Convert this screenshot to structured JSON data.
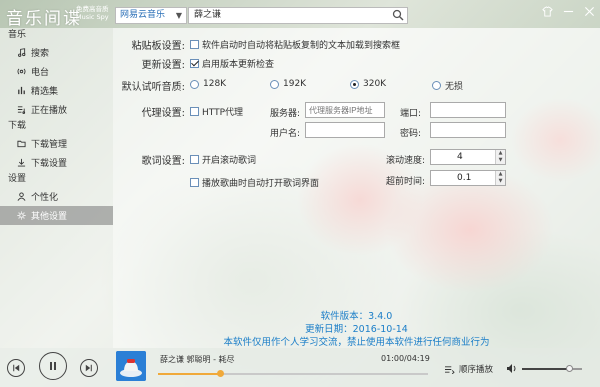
{
  "app": {
    "title": "音乐间谍",
    "subtitle_line1": "免费高音质",
    "subtitle_line2": "Music Spy"
  },
  "search": {
    "source": "网易云音乐",
    "query": "薛之谦"
  },
  "sidebar": {
    "sections": [
      {
        "title": "音乐",
        "items": [
          {
            "label": "搜索",
            "icon": "music-note-icon"
          },
          {
            "label": "电台",
            "icon": "radio-icon"
          },
          {
            "label": "精选集",
            "icon": "chart-bars-icon"
          },
          {
            "label": "正在播放",
            "icon": "playlist-icon"
          }
        ]
      },
      {
        "title": "下载",
        "items": [
          {
            "label": "下载管理",
            "icon": "folder-icon"
          },
          {
            "label": "下载设置",
            "icon": "download-icon"
          }
        ]
      },
      {
        "title": "设置",
        "items": [
          {
            "label": "个性化",
            "icon": "person-icon"
          },
          {
            "label": "其他设置",
            "icon": "gear-icon",
            "active": true
          }
        ]
      }
    ]
  },
  "settings": {
    "clipboard": {
      "label": "粘贴板设置:",
      "option": "软件启动时自动将粘贴板复制的文本加载到搜索框",
      "checked": false
    },
    "update": {
      "label": "更新设置:",
      "option": "启用版本更新检查",
      "checked": true
    },
    "quality": {
      "label": "默认试听音质:",
      "options": [
        "128K",
        "192K",
        "320K",
        "无损"
      ],
      "selected": "320K"
    },
    "proxy": {
      "label": "代理设置:",
      "option": "HTTP代理",
      "checked": false,
      "server_label": "服务器:",
      "server_placeholder": "代理服务器IP地址",
      "port_label": "端口:",
      "user_label": "用户名:",
      "password_label": "密码:"
    },
    "lyrics": {
      "label": "歌词设置:",
      "option_scroll": "开启滚动歌词",
      "option_auto_open": "播放歌曲时自动打开歌词界面",
      "speed_label": "滚动速度:",
      "speed_value": "4",
      "advance_label": "超前时间:",
      "advance_value": "0.1"
    }
  },
  "info": {
    "version": "软件版本：3.4.0",
    "update_date": "更新日期：2016-10-14",
    "notice": "本软件仅用作个人学习交流，禁止使用本软件进行任何商业行为"
  },
  "player": {
    "song": "薛之谦 郭聪明 - 耗尽",
    "time": "01:00/04:19",
    "progress": 0.23,
    "mode": "顺序播放",
    "volume": 0.78
  },
  "colors": {
    "accent": "#1b7ec8",
    "progress": "#f0a93a"
  }
}
